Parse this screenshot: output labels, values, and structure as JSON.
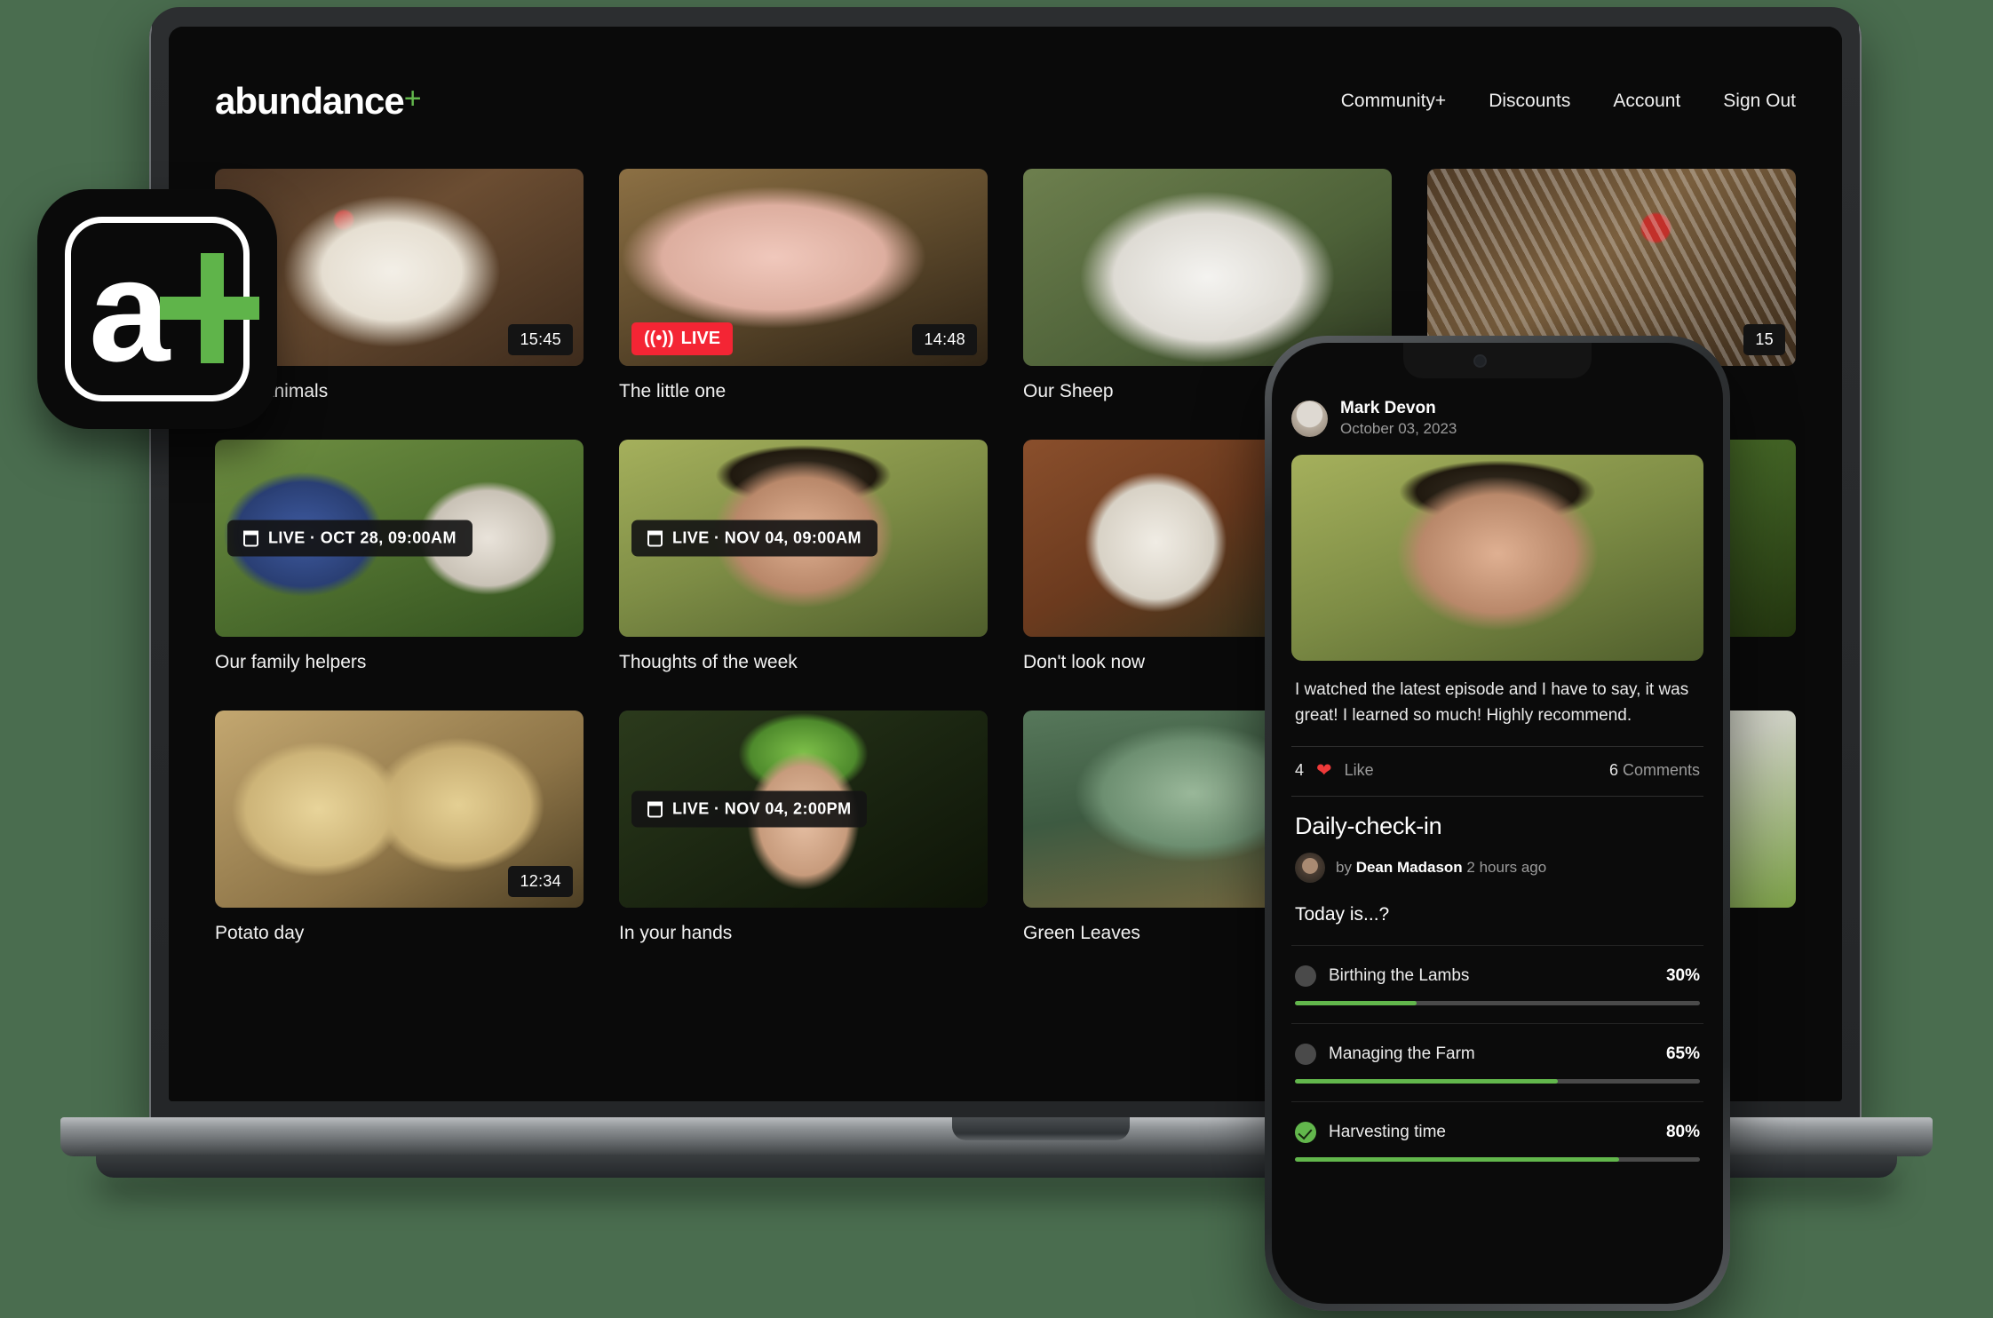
{
  "brand": {
    "name": "abundance",
    "plus": "+"
  },
  "nav": {
    "items": [
      {
        "label": "Community+"
      },
      {
        "label": "Discounts"
      },
      {
        "label": "Account"
      },
      {
        "label": "Sign Out"
      }
    ]
  },
  "colors": {
    "accent_green": "#62b74c",
    "live_red": "#f42534",
    "page_bg": "#0a0a0a",
    "backdrop": "#4a6d4f"
  },
  "app_icon": {
    "letter": "a",
    "plus": "+"
  },
  "videos": [
    {
      "title": "Farm animals",
      "duration": "15:45",
      "live": false,
      "schedule": null,
      "photo": "ph-chicken1"
    },
    {
      "title": "The little one",
      "duration": "14:48",
      "live": true,
      "live_label": "LIVE",
      "schedule": null,
      "photo": "ph-pig"
    },
    {
      "title": "Our Sheep",
      "duration": null,
      "live": false,
      "schedule": null,
      "photo": "ph-sheep"
    },
    {
      "title": "",
      "duration": "15",
      "live": false,
      "schedule": null,
      "photo": "ph-chicken2"
    },
    {
      "title": "Our family helpers",
      "duration": null,
      "live": false,
      "schedule": "LIVE · OCT 28, 09:00AM",
      "photo": "ph-family"
    },
    {
      "title": "Thoughts of the week",
      "duration": null,
      "live": false,
      "schedule": "LIVE · NOV 04, 09:00AM",
      "photo": "ph-farmer"
    },
    {
      "title": "Don't look now",
      "duration": null,
      "live": false,
      "schedule": null,
      "photo": "ph-cow"
    },
    {
      "title": "",
      "duration": null,
      "live": false,
      "schedule": null,
      "photo": "ph-lettuce1"
    },
    {
      "title": "Potato day",
      "duration": "12:34",
      "live": false,
      "schedule": null,
      "photo": "ph-potato"
    },
    {
      "title": "In your hands",
      "duration": null,
      "live": false,
      "schedule": "LIVE · NOV 04, 2:00PM",
      "photo": "ph-hands"
    },
    {
      "title": "Green Leaves",
      "duration": null,
      "live": false,
      "schedule": null,
      "photo": "ph-cabbage"
    },
    {
      "title": "",
      "duration": null,
      "live": false,
      "schedule": null,
      "photo": "ph-lettuce2"
    }
  ],
  "phone": {
    "post": {
      "author": "Mark Devon",
      "date": "October 03, 2023",
      "text": "I watched the latest episode and I have to say, it was great! I learned so much! Highly recommend.",
      "like_count": "4",
      "like_label": "Like",
      "comments_count": "6",
      "comments_label": "Comments"
    },
    "checkin": {
      "title": "Daily-check-in",
      "by_prefix": "by",
      "author": "Dean Madason",
      "time_ago": "2 hours ago",
      "question": "Today is...?",
      "options": [
        {
          "label": "Birthing the Lambs",
          "percent": "30%",
          "value": 30,
          "selected": false
        },
        {
          "label": "Managing the Farm",
          "percent": "65%",
          "value": 65,
          "selected": false
        },
        {
          "label": "Harvesting time",
          "percent": "80%",
          "value": 80,
          "selected": true
        }
      ]
    }
  }
}
